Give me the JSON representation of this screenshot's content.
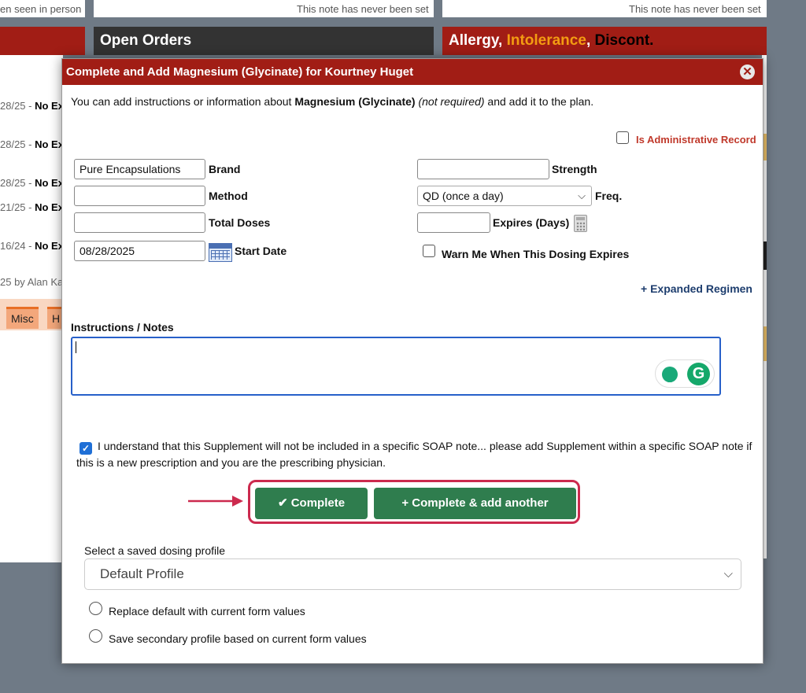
{
  "background": {
    "top_left_note": "en seen in person",
    "top_mid_note": "This note has never been set",
    "top_right_note": "This note has never been set",
    "open_orders_title": "Open Orders",
    "allergy_title": {
      "part1": "Allergy, ",
      "part2": "Intolerance",
      "part3": ", ",
      "part4": "Discont."
    },
    "rows": [
      {
        "date": "28/25 - ",
        "status": "No Ex"
      },
      {
        "date": "28/25 - ",
        "status": "No Ex"
      },
      {
        "date": "28/25 - ",
        "status": "No Ex"
      },
      {
        "date": "21/25 - ",
        "status": "No Ex"
      },
      {
        "date": "16/24 - ",
        "status": "No Ex"
      }
    ],
    "by_line": "25 by Alan Ka",
    "tabs": [
      "Misc",
      "H"
    ],
    "colors": {
      "header_dark": "#333333",
      "header_red": "#a11d15",
      "orange": "#f39c12",
      "tab_orange": "#e86e25"
    }
  },
  "modal": {
    "title": "Complete and Add Magnesium (Glycinate) for Kourtney Huget",
    "close_icon": "close-icon",
    "intro": {
      "before": "You can add instructions or information about ",
      "item": "Magnesium (Glycinate)",
      "note": "(not required)",
      "after": " and add it to the plan."
    },
    "admin_record_label": "Is Administrative Record",
    "fields": {
      "brand": {
        "label": "Brand",
        "value": "Pure Encapsulations"
      },
      "method": {
        "label": "Method",
        "value": ""
      },
      "total_doses": {
        "label": "Total Doses",
        "value": ""
      },
      "start_date": {
        "label": "Start Date",
        "value": "08/28/2025"
      },
      "strength": {
        "label": "Strength",
        "value": ""
      },
      "freq": {
        "label": "Freq.",
        "value": "QD (once a day)"
      },
      "expires": {
        "label": "Expires (Days)",
        "value": ""
      }
    },
    "warn_label": "Warn Me When This Dosing Expires",
    "expanded_regimen": "+ Expanded Regimen",
    "notes_label": "Instructions / Notes",
    "acknowledge": "I understand that this Supplement will not be included in a specific SOAP note... please add Supplement within a specific SOAP note if this is a new prescription and you are the prescribing physician.",
    "buttons": {
      "complete": "Complete",
      "complete_add": "Complete & add another"
    },
    "profile_label": "Select a saved dosing profile",
    "profile_value": "Default Profile",
    "radio_replace": "Replace default with current form values",
    "radio_secondary": "Save secondary profile based on current form values"
  }
}
